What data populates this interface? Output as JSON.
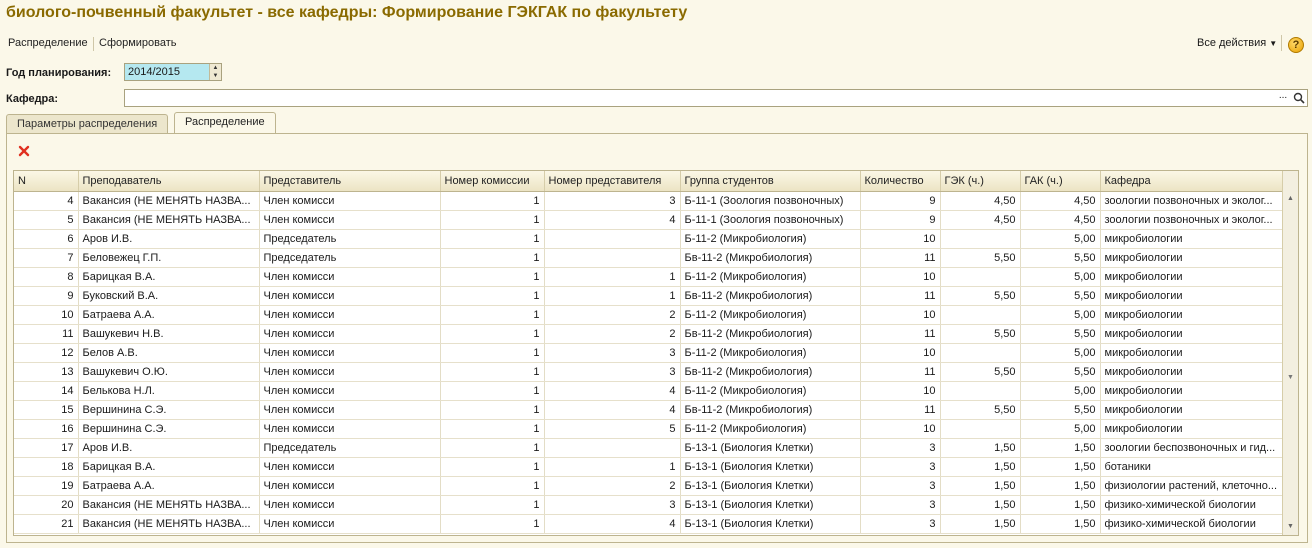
{
  "window": {
    "title": "биолого-почвенный факультет - все кафедры: Формирование ГЭКГАК по факультету"
  },
  "toolbar": {
    "distribution_label": "Распределение",
    "form_label": "Сформировать",
    "all_actions_label": "Все действия",
    "help_label": "?"
  },
  "filters": {
    "year_label": "Год планирования:",
    "year_value": "2014/2015",
    "department_label": "Кафедра:",
    "department_value": "",
    "department_dots": "..."
  },
  "tabs": [
    {
      "label": "Параметры распределения",
      "active": false
    },
    {
      "label": "Распределение",
      "active": true
    }
  ],
  "table": {
    "columns": [
      "N",
      "Преподаватель",
      "Представитель",
      "Номер комиссии",
      "Номер представителя",
      "Группа студентов",
      "Количество",
      "ГЭК (ч.)",
      "ГАК (ч.)",
      "Кафедра"
    ],
    "rows": [
      [
        "4",
        "Вакансия (НЕ МЕНЯТЬ НАЗВА...",
        "Член комисси",
        "1",
        "3",
        "Б-11-1 (Зоология позвоночных)",
        "9",
        "4,50",
        "4,50",
        "зоологии позвоночных и эколог..."
      ],
      [
        "5",
        "Вакансия (НЕ МЕНЯТЬ НАЗВА...",
        "Член комисси",
        "1",
        "4",
        "Б-11-1 (Зоология позвоночных)",
        "9",
        "4,50",
        "4,50",
        "зоологии позвоночных и эколог..."
      ],
      [
        "6",
        "Аров И.В.",
        "Председатель",
        "1",
        "",
        "Б-11-2 (Микробиология)",
        "10",
        "",
        "5,00",
        "микробиологии"
      ],
      [
        "7",
        "Беловежец Г.П.",
        "Председатель",
        "1",
        "",
        "Бв-11-2 (Микробиология)",
        "11",
        "5,50",
        "5,50",
        "микробиологии"
      ],
      [
        "8",
        "Барицкая В.А.",
        "Член комисси",
        "1",
        "1",
        "Б-11-2 (Микробиология)",
        "10",
        "",
        "5,00",
        "микробиологии"
      ],
      [
        "9",
        "Буковский В.А.",
        "Член комисси",
        "1",
        "1",
        "Бв-11-2 (Микробиология)",
        "11",
        "5,50",
        "5,50",
        "микробиологии"
      ],
      [
        "10",
        "Батраева А.А.",
        "Член комисси",
        "1",
        "2",
        "Б-11-2 (Микробиология)",
        "10",
        "",
        "5,00",
        "микробиологии"
      ],
      [
        "11",
        "Вашукевич Н.В.",
        "Член комисси",
        "1",
        "2",
        "Бв-11-2 (Микробиология)",
        "11",
        "5,50",
        "5,50",
        "микробиологии"
      ],
      [
        "12",
        "Белов А.В.",
        "Член комисси",
        "1",
        "3",
        "Б-11-2 (Микробиология)",
        "10",
        "",
        "5,00",
        "микробиологии"
      ],
      [
        "13",
        "Вашукевич О.Ю.",
        "Член комисси",
        "1",
        "3",
        "Бв-11-2 (Микробиология)",
        "11",
        "5,50",
        "5,50",
        "микробиологии"
      ],
      [
        "14",
        "Белькова Н.Л.",
        "Член комисси",
        "1",
        "4",
        "Б-11-2 (Микробиология)",
        "10",
        "",
        "5,00",
        "микробиологии"
      ],
      [
        "15",
        "Вершинина С.Э.",
        "Член комисси",
        "1",
        "4",
        "Бв-11-2 (Микробиология)",
        "11",
        "5,50",
        "5,50",
        "микробиологии"
      ],
      [
        "16",
        "Вершинина С.Э.",
        "Член комисси",
        "1",
        "5",
        "Б-11-2 (Микробиология)",
        "10",
        "",
        "5,00",
        "микробиологии"
      ],
      [
        "17",
        "Аров И.В.",
        "Председатель",
        "1",
        "",
        "Б-13-1 (Биология Клетки)",
        "3",
        "1,50",
        "1,50",
        "зоологии беспозвоночных и гид..."
      ],
      [
        "18",
        "Барицкая В.А.",
        "Член комисси",
        "1",
        "1",
        "Б-13-1 (Биология Клетки)",
        "3",
        "1,50",
        "1,50",
        "ботаники"
      ],
      [
        "19",
        "Батраева А.А.",
        "Член комисси",
        "1",
        "2",
        "Б-13-1 (Биология Клетки)",
        "3",
        "1,50",
        "1,50",
        "физиологии растений, клеточно..."
      ],
      [
        "20",
        "Вакансия (НЕ МЕНЯТЬ НАЗВА...",
        "Член комисси",
        "1",
        "3",
        "Б-13-1 (Биология Клетки)",
        "3",
        "1,50",
        "1,50",
        "физико-химической биологии"
      ],
      [
        "21",
        "Вакансия (НЕ МЕНЯТЬ НАЗВА...",
        "Член комисси",
        "1",
        "4",
        "Б-13-1 (Биология Клетки)",
        "3",
        "1,50",
        "1,50",
        "физико-химической биологии"
      ]
    ]
  },
  "colors": {
    "title": "#8a6a00",
    "background": "#fbf8e9",
    "year_field": "#b5e8f0",
    "delete_icon": "#e03020"
  }
}
